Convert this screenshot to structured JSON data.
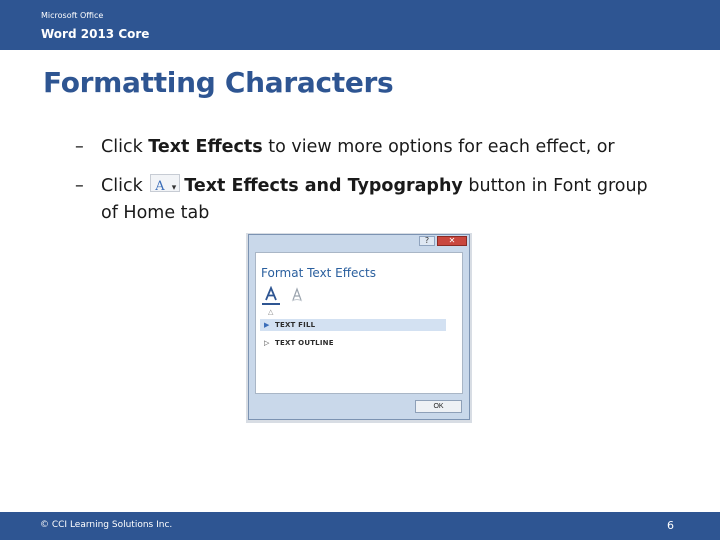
{
  "header": {
    "product": "Microsoft Office",
    "course": "Word 2013 Core"
  },
  "slide": {
    "title": "Formatting Characters",
    "bullets": [
      {
        "dash": "–",
        "pre": "Click ",
        "bold": "Text Effects",
        "post": " to view more options for each effect, or"
      },
      {
        "dash": "–",
        "pre": "Click ",
        "icon": "text-effects-icon",
        "bold": "Text Effects and Typography",
        "post": " button in Font group of Home tab"
      }
    ]
  },
  "dialog": {
    "title_help": "?",
    "title_close": "✕",
    "heading": "Format Text Effects",
    "sections": [
      {
        "label": "TEXT FILL",
        "expanded": false,
        "highlighted": true
      },
      {
        "label": "TEXT OUTLINE",
        "expanded": false,
        "highlighted": false
      }
    ],
    "ok_label": "OK"
  },
  "footer": {
    "copyright": "© CCI Learning Solutions Inc.",
    "page": "6"
  },
  "colors": {
    "brand": "#2e5592",
    "dialog_frame": "#c9d8ea",
    "highlight": "#d3e1f2"
  }
}
